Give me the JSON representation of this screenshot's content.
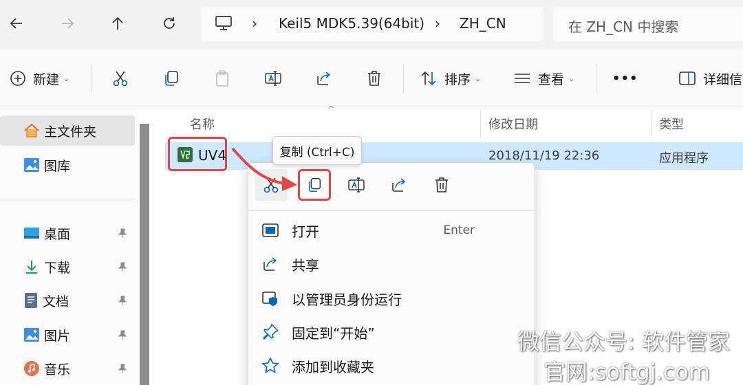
{
  "breadcrumb": {
    "items": [
      "Keil5 MDK5.39(64bit)",
      "ZH_CN"
    ]
  },
  "search": {
    "placeholder": "在 ZH_CN 中搜索"
  },
  "toolbar": {
    "new_label": "新建",
    "sort_label": "排序",
    "view_label": "查看",
    "more_label": "•••",
    "details_label": "详细信"
  },
  "sidebar": {
    "items": [
      {
        "label": "主文件夹",
        "icon": "home-icon"
      },
      {
        "label": "图库",
        "icon": "gallery-icon"
      },
      {
        "label": "桌面",
        "icon": "desktop-icon"
      },
      {
        "label": "下载",
        "icon": "download-icon"
      },
      {
        "label": "文档",
        "icon": "document-icon"
      },
      {
        "label": "图片",
        "icon": "picture-icon"
      },
      {
        "label": "音乐",
        "icon": "music-icon"
      }
    ]
  },
  "columns": {
    "name": "名称",
    "modified": "修改日期",
    "type": "类型"
  },
  "file": {
    "name": "UV4",
    "modified": "2018/11/19 22:36",
    "type": "应用程序"
  },
  "tooltip": {
    "text": "复制 (Ctrl+C)"
  },
  "context_menu": {
    "items": [
      {
        "label": "打开",
        "shortcut": "Enter"
      },
      {
        "label": "共享"
      },
      {
        "label": "以管理员身份运行"
      },
      {
        "label": "固定到“开始”"
      },
      {
        "label": "添加到收藏夹"
      }
    ]
  },
  "watermark": {
    "line1": "微信公众号: 软件管家",
    "line2": "官网:softgj.com"
  },
  "colors": {
    "highlight": "#e04848",
    "selection": "#cde8ff",
    "accent": "#0067c0"
  }
}
